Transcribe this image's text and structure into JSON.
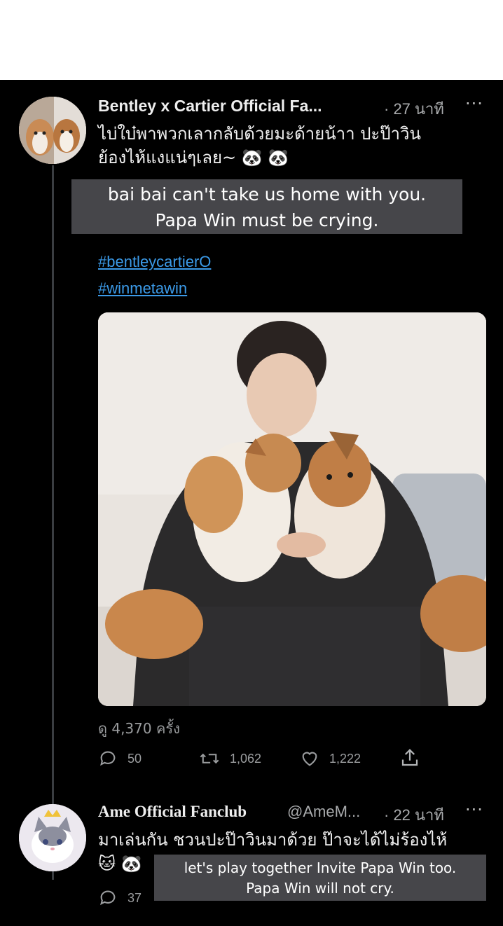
{
  "tweets": [
    {
      "author": "Bentley x Cartier Official Fa...",
      "time": "· 27 นาที",
      "more": "···",
      "text_line1": "ไบ่ใบ๋พาพวกเลากลับด้วยมะด้ายน้าา ปะป๊าวิน",
      "text_line2": "ย้องไห้แงแน่ๆเลย~ 🐼 🐼",
      "subtitle_line1": "bai bai can't take us home with you.",
      "subtitle_line2": "Papa Win must be crying.",
      "hashtags": [
        "#bentleycartierO",
        "#winmetawin"
      ],
      "views": "ดู 4,370 ครั้ง",
      "replies": "50",
      "retweets": "1,062",
      "likes": "1,222"
    },
    {
      "author": "Ame Official Fanclub",
      "handle": "@AmeM...",
      "time": "· 22 นาที",
      "more": "···",
      "text_line1": "มาเล่นกัน ชวนปะป๊าวินมาด้วย ป๊าจะได้ไม่ร้องไห้",
      "text_line2": "🐱 🐼",
      "subtitle_line1": "let's play together  Invite Papa Win too.",
      "subtitle_line2": "Papa Win will not cry.",
      "replies": "37"
    }
  ],
  "icons": {
    "reply": "reply-icon",
    "retweet": "retweet-icon",
    "like": "heart-icon",
    "share": "share-icon"
  },
  "colors": {
    "background": "#000000",
    "link": "#3b9ae8",
    "muted": "#9a9c9e",
    "subtitle_bg": "#505054"
  }
}
